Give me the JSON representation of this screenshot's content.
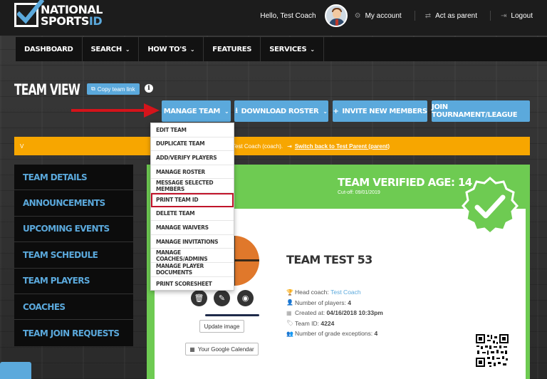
{
  "brand": {
    "line1": "NATIONAL",
    "line2_a": "SPORTS",
    "line2_b": "ID"
  },
  "topbar": {
    "greeting": "Hello, Test Coach",
    "my_account": "My account",
    "act_as_parent": "Act as parent",
    "logout": "Logout"
  },
  "nav": {
    "items": [
      {
        "label": "DASHBOARD"
      },
      {
        "label": "SEARCH"
      },
      {
        "label": "HOW TO'S"
      },
      {
        "label": "FEATURES"
      },
      {
        "label": "SERVICES"
      }
    ]
  },
  "page": {
    "title": "TEAM VIEW",
    "copy_link": "Copy team link",
    "info": "i"
  },
  "actions": {
    "manage_team": "MANAGE TEAM",
    "download_roster": "DOWNLOAD ROSTER",
    "invite": "INVITE NEW MEMBERS",
    "join": "JOIN TOURNAMENT/LEAGUE"
  },
  "alert": {
    "visible_prefix": "V",
    "text": "Test Coach (coach).",
    "link": "Switch back to Test Parent (parent)"
  },
  "sidebar": {
    "items": [
      {
        "label": "TEAM DETAILS"
      },
      {
        "label": "ANNOUNCEMENTS"
      },
      {
        "label": "UPCOMING EVENTS"
      },
      {
        "label": "TEAM SCHEDULE"
      },
      {
        "label": "TEAM PLAYERS"
      },
      {
        "label": "COACHES"
      },
      {
        "label": "TEAM JOIN REQUESTS"
      }
    ]
  },
  "team": {
    "verified_age": "TEAM VERIFIED AGE: 14",
    "cutoff_label": "Cut-off:",
    "cutoff_date": "09/01/2019",
    "name": "TEAM TEST 53",
    "head_coach_label": "Head coach:",
    "head_coach": "Test Coach",
    "players_label": "Number of players:",
    "players": "4",
    "created_label": "Created at:",
    "created": "04/16/2018 10:33pm",
    "team_id_label": "Team ID:",
    "team_id": "4224",
    "grade_exc_label": "Number of grade exceptions:",
    "grade_exc": "4",
    "update_image": "Update image",
    "google_calendar": "Your Google Calendar"
  },
  "manage_menu": {
    "items": [
      {
        "label": "EDIT TEAM"
      },
      {
        "label": "DUPLICATE TEAM"
      },
      {
        "label": "ADD/VERIFY PLAYERS"
      },
      {
        "label": "MANAGE ROSTER"
      },
      {
        "label": "MESSAGE SELECTED MEMBERS"
      },
      {
        "label": "PRINT TEAM ID"
      },
      {
        "label": "DELETE TEAM"
      },
      {
        "label": "MANAGE WAIVERS"
      },
      {
        "label": "MANAGE INVITATIONS"
      },
      {
        "label": "MANAGE COACHES/ADMINS"
      },
      {
        "label": "MANAGE PLAYER DOCUMENTS"
      },
      {
        "label": "PRINT SCORESHEET"
      }
    ],
    "highlighted": "PRINT TEAM ID"
  },
  "colors": {
    "accent": "#5ba9dc",
    "green": "#6ecb52",
    "alert": "#f7a600",
    "highlight": "#c0142a"
  }
}
